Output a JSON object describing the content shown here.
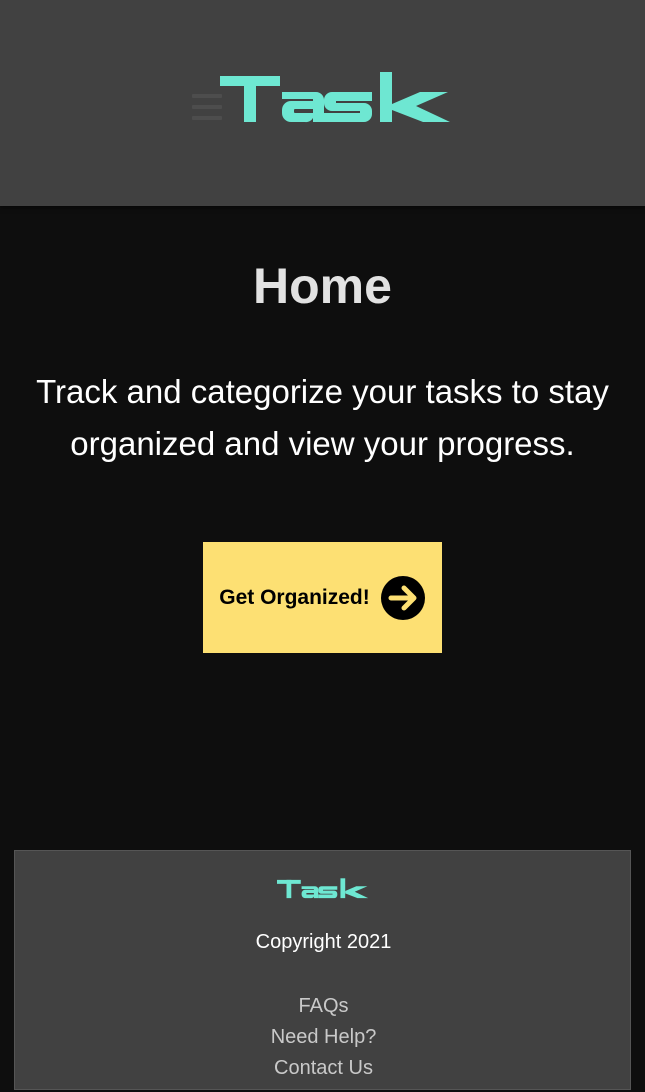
{
  "header": {
    "logo_text": "Task",
    "menu_icon": "hamburger-menu-icon"
  },
  "main": {
    "title": "Home",
    "tagline": "Track and categorize your tasks to stay organized and view your progress.",
    "cta_label": "Get Organized!",
    "cta_icon": "arrow-right-circle-icon"
  },
  "footer": {
    "logo_text": "Task",
    "copyright": "Copyright 2021",
    "links": [
      "FAQs",
      "Need Help?",
      "Contact Us"
    ]
  },
  "colors": {
    "accent": "#6ee7d2",
    "header_bg": "#414141",
    "page_bg": "#0e0e0e",
    "cta_bg": "#fde073"
  }
}
